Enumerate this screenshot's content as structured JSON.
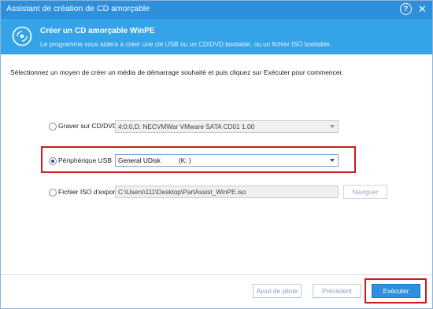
{
  "window": {
    "title": "Assistant de création de CD amorçable",
    "help_label": "?",
    "close_label": "✕"
  },
  "banner": {
    "title": "Créer un CD amorçable WinPE",
    "subtitle": "Le programme vous aidera à créer une clé USB ou un CD/DVD bootable, ou un fichier ISO bootable.",
    "icon": "cd-burn-icon"
  },
  "instructions": "Sélectionnez un moyen de créer un média de démarrage souhaité et puis cliquez sur Exécuter pour commencer.",
  "options": {
    "burn_cd": {
      "label": "Graver sur CD/DVD",
      "selected": false,
      "value": "4:0:0,D: NECVMWar VMware SATA CD01 1.00"
    },
    "usb": {
      "label": "Périphérique USB",
      "selected": true,
      "value": "General UDisk          (K: )"
    },
    "iso": {
      "label": "Fichier ISO d'export",
      "selected": false,
      "value": "C:\\Users\\111\\Desktop\\PartAssist_WinPE.iso",
      "browse_label": "Naviguer"
    }
  },
  "footer": {
    "add_driver_label": "Ajout de pilote",
    "previous_label": "Précédent",
    "execute_label": "Exécuter"
  },
  "colors": {
    "titlebar": "#2e8fdc",
    "banner": "#35a3e8",
    "highlight": "#cc1b1b"
  }
}
